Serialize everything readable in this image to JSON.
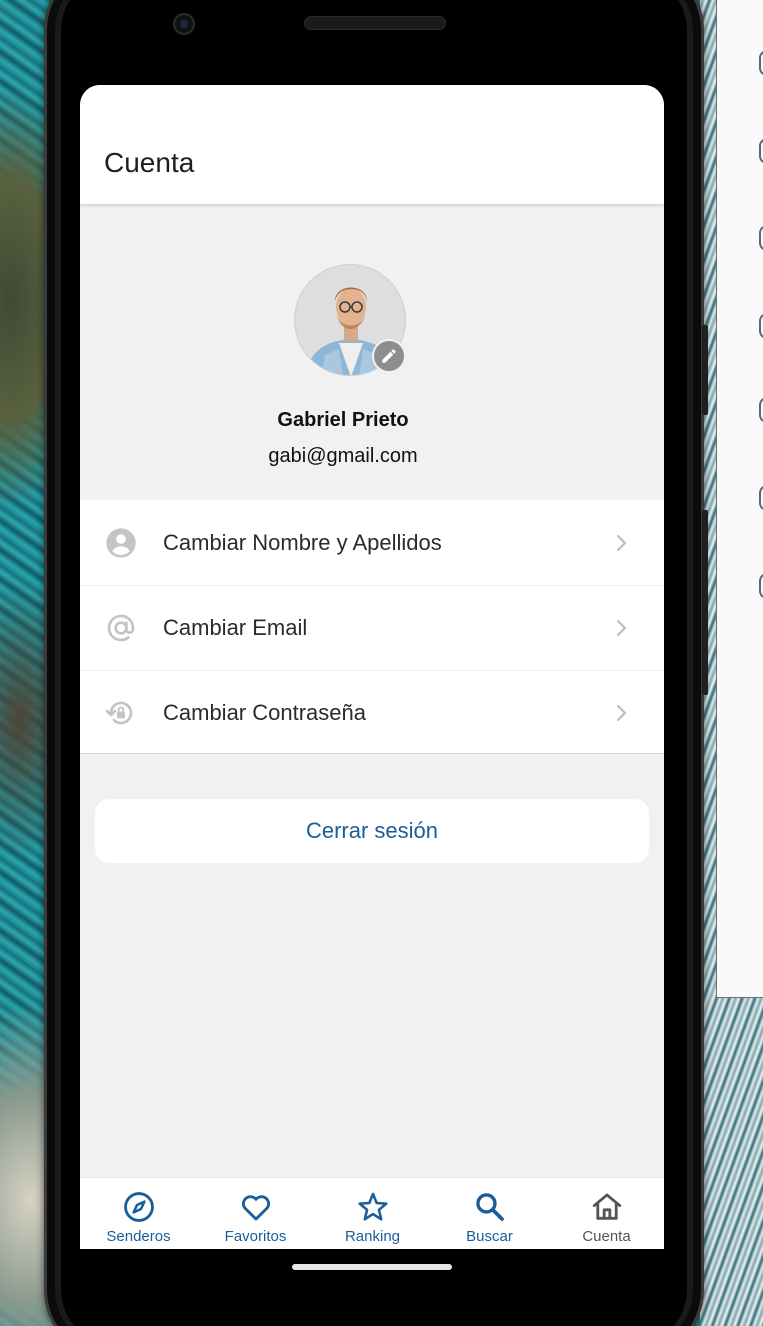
{
  "appbar": {
    "title": "Cuenta"
  },
  "profile": {
    "name": "Gabriel Prieto",
    "email": "gabi@gmail.com",
    "avatar_icon": "user-photo",
    "edit_icon": "pencil-icon"
  },
  "menu": {
    "items": [
      {
        "label": "Cambiar Nombre y Apellidos",
        "icon": "account-circle-icon"
      },
      {
        "label": "Cambiar Email",
        "icon": "at-sign-icon"
      },
      {
        "label": "Cambiar Contraseña",
        "icon": "lock-reset-icon"
      }
    ]
  },
  "logout": {
    "label": "Cerrar sesión"
  },
  "bottom_nav": {
    "items": [
      {
        "label": "Senderos",
        "icon": "compass-icon",
        "active": true
      },
      {
        "label": "Favoritos",
        "icon": "heart-icon",
        "active": true
      },
      {
        "label": "Ranking",
        "icon": "star-icon",
        "active": true
      },
      {
        "label": "Buscar",
        "icon": "search-icon",
        "active": true
      },
      {
        "label": "Cuenta",
        "icon": "home-icon",
        "active": false
      }
    ]
  },
  "colors": {
    "accent": "#1a5e99",
    "screen_bg": "#f1f1f1",
    "card_bg": "#ffffff",
    "icon_gray": "#c4c4c4"
  }
}
